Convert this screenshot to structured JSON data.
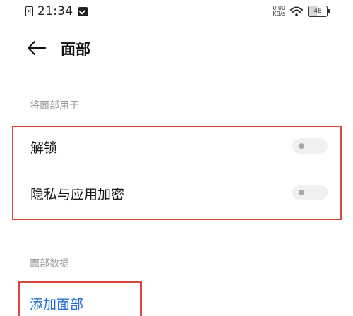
{
  "status_bar": {
    "sim_glyph": "×",
    "time": "21:34",
    "net_speed_value": "0.00",
    "net_speed_unit": "KB/s",
    "battery": "48"
  },
  "header": {
    "back_glyph": "←",
    "title": "面部"
  },
  "usage_section": {
    "label": "将面部用于",
    "items": [
      {
        "label": "解锁",
        "enabled": false
      },
      {
        "label": "隐私与应用加密",
        "enabled": false
      }
    ]
  },
  "data_section": {
    "label": "面部数据",
    "add_label": "添加面部"
  },
  "colors": {
    "highlight_border": "#d9483b",
    "link_blue": "#1f6fd6",
    "section_gray": "#9a9a9a",
    "toggle_off_track": "#f0f0f0"
  }
}
